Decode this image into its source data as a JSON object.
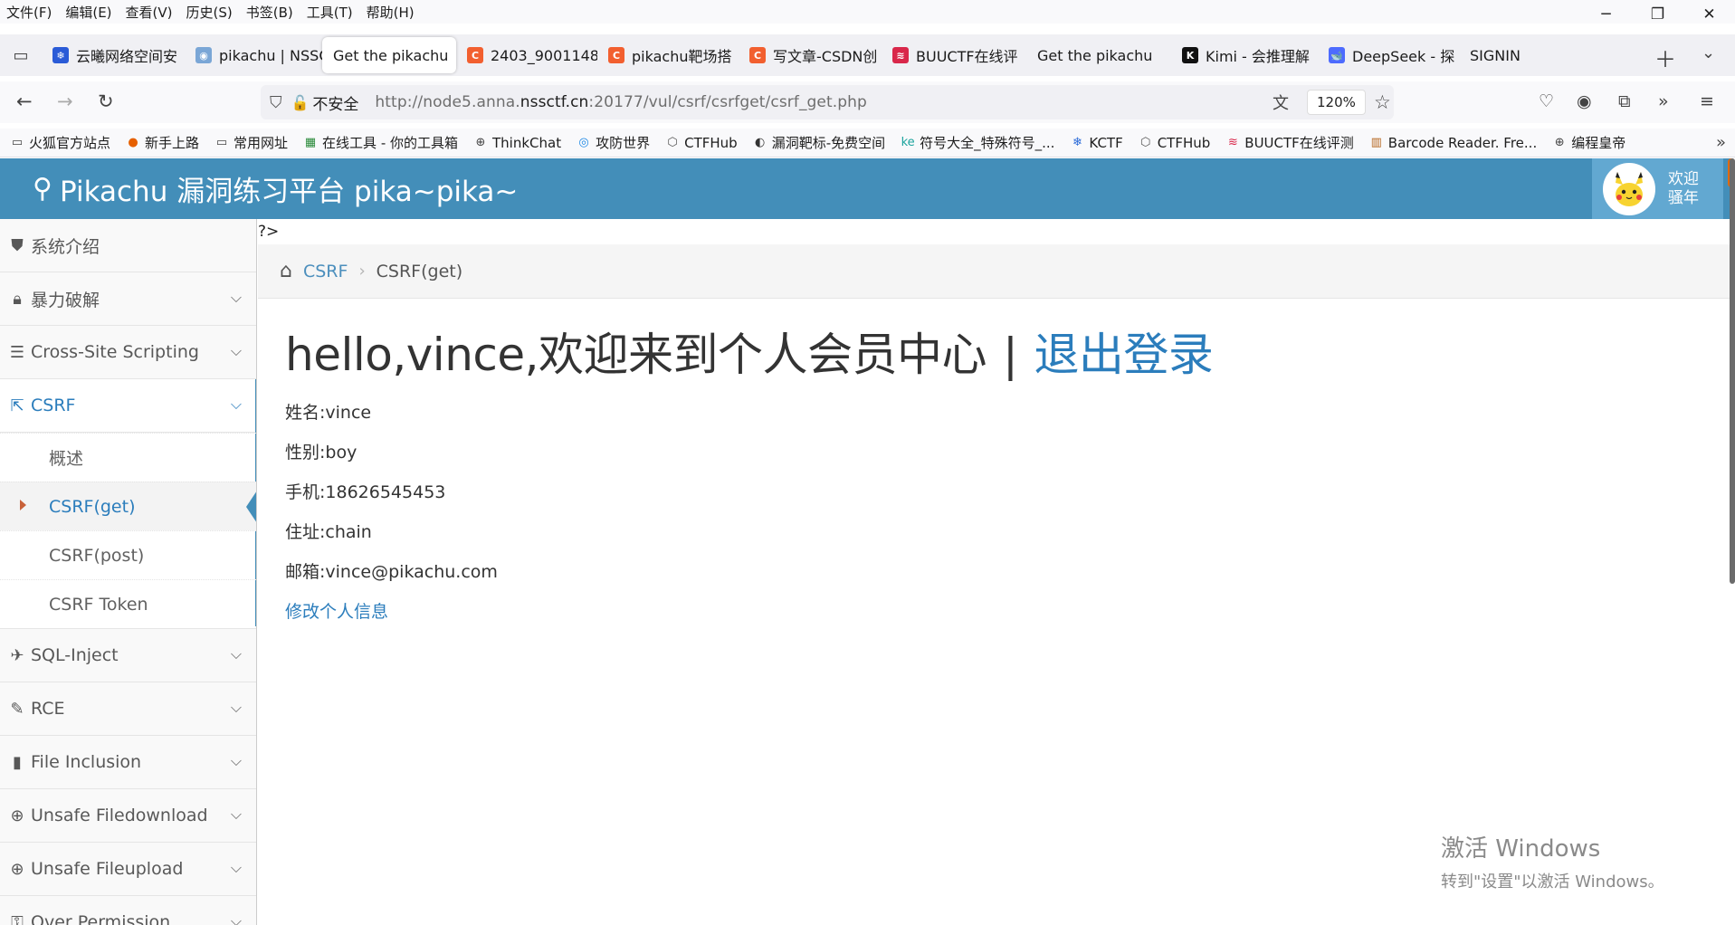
{
  "menubar": {
    "items": [
      "文件(F)",
      "编辑(E)",
      "查看(V)",
      "历史(S)",
      "书签(B)",
      "工具(T)",
      "帮助(H)"
    ]
  },
  "tabs": [
    {
      "label": "云曦网络空间安",
      "favicon_color": "#2a5bd7",
      "favicon_glyph": "❄"
    },
    {
      "label": "pikachu | NSSC",
      "favicon_color": "#7aa6d6",
      "favicon_glyph": "◉"
    },
    {
      "label": "Get the pikachu",
      "favicon_color": "",
      "favicon_glyph": "",
      "active": true,
      "close": "✕"
    },
    {
      "label": "2403_9001148",
      "favicon_color": "#f25f2f",
      "favicon_glyph": "C"
    },
    {
      "label": "pikachu靶场搭",
      "favicon_color": "#f25f2f",
      "favicon_glyph": "C"
    },
    {
      "label": "写文章-CSDN创",
      "favicon_color": "#f25f2f",
      "favicon_glyph": "C"
    },
    {
      "label": "BUUCTF在线评",
      "favicon_color": "#d9274a",
      "favicon_glyph": "≋"
    },
    {
      "label": "Get the pikachu",
      "favicon_color": "",
      "favicon_glyph": ""
    },
    {
      "label": "Kimi - 会推理解",
      "favicon_color": "#111111",
      "favicon_glyph": "K"
    },
    {
      "label": "DeepSeek - 探",
      "favicon_color": "#4d6bfe",
      "favicon_glyph": "🐋"
    },
    {
      "label": "SIGNIN",
      "favicon_color": "",
      "favicon_glyph": ""
    }
  ],
  "navbar": {
    "insecure_label": "不安全",
    "url_prefix": "http://node5.anna.",
    "url_domain": "nssctf.cn",
    "url_suffix": ":20177/vul/csrf/csrfget/csrf_get.php",
    "zoom": "120%"
  },
  "bookmarks": [
    {
      "label": "火狐官方站点",
      "icon": "folder"
    },
    {
      "label": "新手上路",
      "icon": "firefox"
    },
    {
      "label": "常用网址",
      "icon": "folder"
    },
    {
      "label": "在线工具 - 你的工具箱",
      "icon": "toolbox"
    },
    {
      "label": "ThinkChat",
      "icon": "globe"
    },
    {
      "label": "攻防世界",
      "icon": "adworld"
    },
    {
      "label": "CTFHub",
      "icon": "ctfhub"
    },
    {
      "label": "漏洞靶标-免费空间",
      "icon": "target"
    },
    {
      "label": "符号大全_特殊符号_...",
      "icon": "ke"
    },
    {
      "label": "KCTF",
      "icon": "snowflake"
    },
    {
      "label": "CTFHub",
      "icon": "ctfhub"
    },
    {
      "label": "BUUCTF在线评测",
      "icon": "buuctf"
    },
    {
      "label": "Barcode Reader. Fre...",
      "icon": "barcode"
    },
    {
      "label": "编程皇帝",
      "icon": "globe"
    }
  ],
  "header": {
    "brand": "Pikachu 漏洞练习平台 pika~pika~",
    "welcome_line1": "欢迎",
    "welcome_line2": "骚年"
  },
  "sidebar": {
    "items": [
      {
        "label": "系统介绍",
        "icon": "tags-icon",
        "chevron": false
      },
      {
        "label": "暴力破解",
        "icon": "lock-icon",
        "chevron": true
      },
      {
        "label": "Cross-Site Scripting",
        "icon": "list-icon",
        "chevron": true
      },
      {
        "label": "CSRF",
        "icon": "share-icon",
        "chevron": true,
        "open": true
      }
    ],
    "csrf_sub": [
      "概述",
      "CSRF(get)",
      "CSRF(post)",
      "CSRF Token"
    ],
    "items_after": [
      {
        "label": "SQL-Inject",
        "icon": "plane-icon"
      },
      {
        "label": "RCE",
        "icon": "pencil-icon"
      },
      {
        "label": "File Inclusion",
        "icon": "file-icon"
      },
      {
        "label": "Unsafe Filedownload",
        "icon": "download-icon"
      },
      {
        "label": "Unsafe Fileupload",
        "icon": "upload-icon"
      },
      {
        "label": "Over Permission",
        "icon": "key-icon"
      }
    ]
  },
  "content": {
    "php_tag": "?>",
    "breadcrumb": {
      "parent": "CSRF",
      "current": "CSRF(get)"
    },
    "greeting": "hello,vince,欢迎来到个人会员中心",
    "separator": "|",
    "logout": "退出登录",
    "profile": [
      "姓名:vince",
      "性别:boy",
      "手机:18626545453",
      "住址:chain",
      "邮箱:vince@pikachu.com"
    ],
    "edit_link": "修改个人信息"
  },
  "watermark": {
    "line1": "激活 Windows",
    "line2": "转到\"设置\"以激活 Windows。"
  },
  "colors": {
    "header_blue": "#438eb9",
    "link_blue": "#2b7dbc",
    "user_box": "#62a8d1"
  }
}
